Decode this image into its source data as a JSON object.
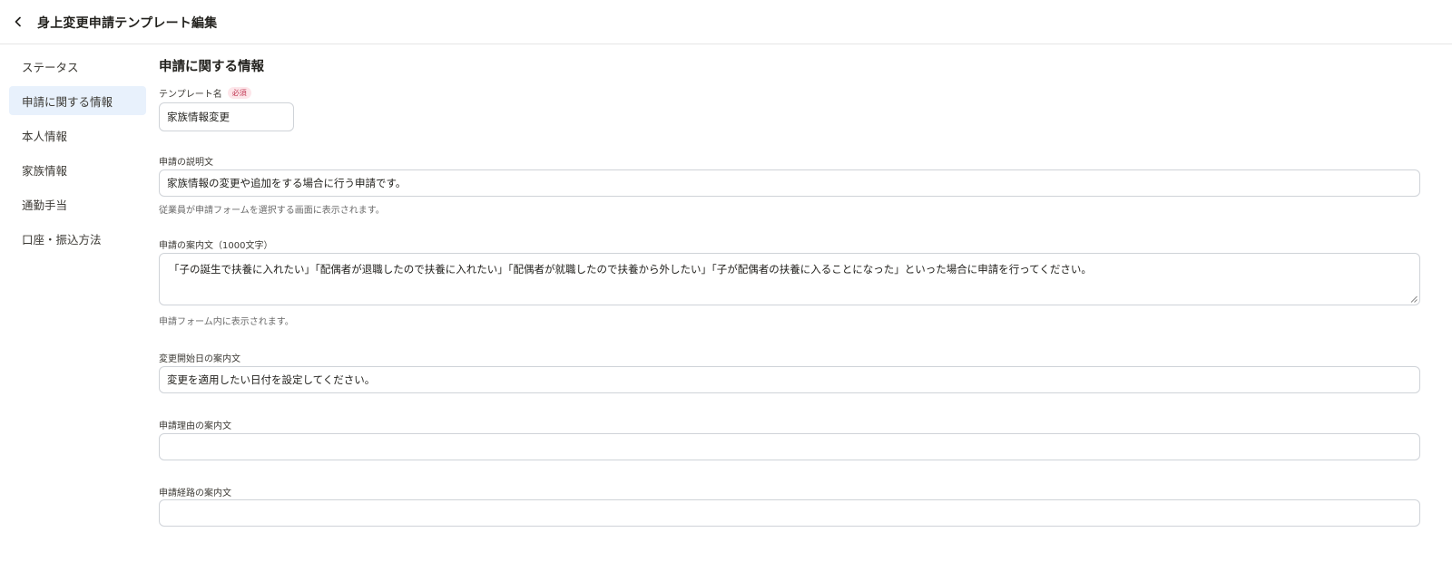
{
  "header": {
    "title": "身上変更申請テンプレート編集",
    "back_icon": "chevron-left-icon"
  },
  "sidebar": {
    "items": [
      {
        "label": "ステータス",
        "active": false
      },
      {
        "label": "申請に関する情報",
        "active": true
      },
      {
        "label": "本人情報",
        "active": false
      },
      {
        "label": "家族情報",
        "active": false
      },
      {
        "label": "通勤手当",
        "active": false
      },
      {
        "label": "口座・振込方法",
        "active": false
      }
    ]
  },
  "main": {
    "section_title": "申請に関する情報",
    "template_name": {
      "label": "テンプレート名",
      "required_badge": "必須",
      "value": "家族情報変更"
    },
    "description": {
      "label": "申請の説明文",
      "value": "家族情報の変更や追加をする場合に行う申請です。",
      "help": "従業員が申請フォームを選択する画面に表示されます。"
    },
    "guidance": {
      "label": "申請の案内文（1000文字）",
      "value": "「子の誕生で扶養に入れたい」「配偶者が退職したので扶養に入れたい」「配偶者が就職したので扶養から外したい」「子が配偶者の扶養に入ることになった」といった場合に申請を行ってください。",
      "help": "申請フォーム内に表示されます。"
    },
    "start_date_guidance": {
      "label": "変更開始日の案内文",
      "value": "変更を適用したい日付を設定してください。"
    },
    "reason_guidance": {
      "label": "申請理由の案内文",
      "value": ""
    },
    "route_guidance": {
      "label": "申請経路の案内文",
      "value": ""
    }
  },
  "colors": {
    "active_bg": "#e8f1fc",
    "required_text": "#c23b56",
    "required_bg": "#fde6ea",
    "border": "#cfd3d8"
  }
}
